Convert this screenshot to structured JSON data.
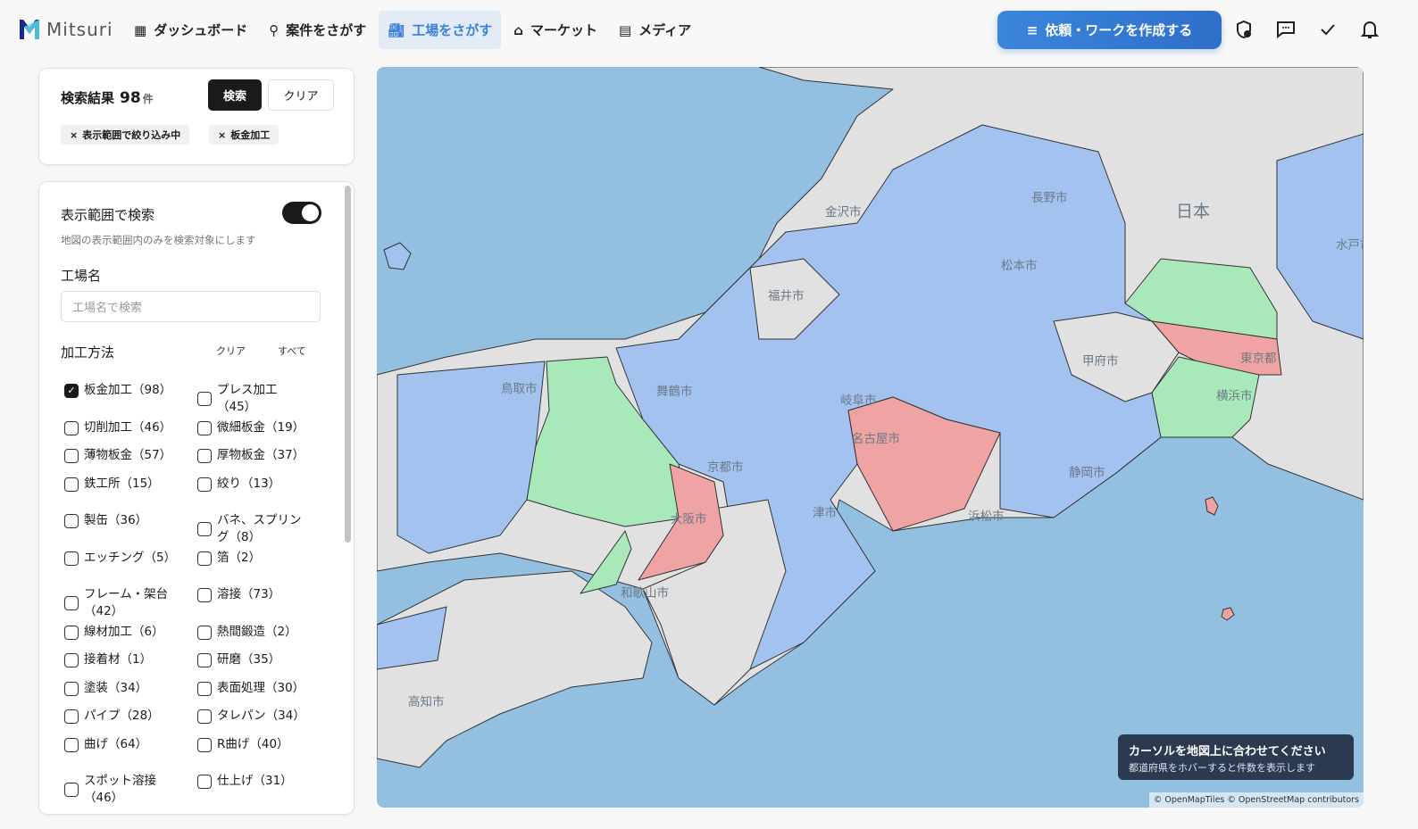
{
  "header": {
    "logo": "Mitsuri",
    "nav": [
      {
        "label": "ダッシュボード",
        "icon": "grid-icon"
      },
      {
        "label": "案件をさがす",
        "icon": "search-icon"
      },
      {
        "label": "工場をさがす",
        "icon": "factory-icon",
        "active": true
      },
      {
        "label": "マーケット",
        "icon": "store-icon"
      },
      {
        "label": "メディア",
        "icon": "newspaper-icon"
      }
    ],
    "cta_label": "依頼・ワークを作成する",
    "accent": "#3a86db"
  },
  "results": {
    "title": "検索結果",
    "count": "98",
    "unit": "件",
    "search_label": "検索",
    "clear_label": "クリア",
    "chips": [
      "表示範囲で絞り込み中",
      "板金加工"
    ]
  },
  "filters": {
    "viewport_title": "表示範囲で検索",
    "viewport_on": true,
    "viewport_hint": "地図の表示範囲内のみを検索対象にします",
    "name_title": "工場名",
    "name_placeholder": "工場名で検索",
    "method_title": "加工方法",
    "method_clear": "クリア",
    "method_all": "すべて",
    "methods": [
      {
        "label": "板金加工（98）",
        "checked": true
      },
      {
        "label": "プレス加工（45）",
        "checked": false
      },
      {
        "label": "切削加工（46）",
        "checked": false
      },
      {
        "label": "微細板金（19）",
        "checked": false
      },
      {
        "label": "薄物板金（57）",
        "checked": false
      },
      {
        "label": "厚物板金（37）",
        "checked": false
      },
      {
        "label": "鉄工所（15）",
        "checked": false
      },
      {
        "label": "絞り（13）",
        "checked": false
      },
      {
        "label": "製缶（36）",
        "checked": false
      },
      {
        "label": "バネ、スプリング（8）",
        "checked": false
      },
      {
        "label": "エッチング（5）",
        "checked": false
      },
      {
        "label": "箔（2）",
        "checked": false
      },
      {
        "label": "フレーム・架台（42）",
        "checked": false
      },
      {
        "label": "溶接（73）",
        "checked": false
      },
      {
        "label": "線材加工（6）",
        "checked": false
      },
      {
        "label": "熱間鍛造（2）",
        "checked": false
      },
      {
        "label": "接着材（1）",
        "checked": false
      },
      {
        "label": "研磨（35）",
        "checked": false
      },
      {
        "label": "塗装（34）",
        "checked": false
      },
      {
        "label": "表面処理（30）",
        "checked": false
      },
      {
        "label": "パイプ（28）",
        "checked": false
      },
      {
        "label": "タレパン（34）",
        "checked": false
      },
      {
        "label": "曲げ（64）",
        "checked": false
      },
      {
        "label": "R曲げ（40）",
        "checked": false
      },
      {
        "label": "スポット溶接（46）",
        "checked": false
      },
      {
        "label": "仕上げ（31）",
        "checked": false
      }
    ]
  },
  "map": {
    "cities": [
      "金沢市",
      "長野市",
      "日本",
      "水戸市",
      "松本市",
      "福井市",
      "甲府市",
      "東京都",
      "鳥取市",
      "舞鶴市",
      "岐阜市",
      "横浜市",
      "名古屋市",
      "京都市",
      "静岡市",
      "大阪市",
      "津市",
      "浜松市",
      "和歌山市",
      "高知市"
    ],
    "tooltip_title": "カーソルを地図上に合わせてください",
    "tooltip_hint": "都道府県をホバーすると件数を表示します",
    "attribution": "© OpenMapTiles © OpenStreetMap contributors",
    "colors": {
      "sea": "#93bfe0",
      "land": "#e1e1e1",
      "tier_low": "#a3c2ef",
      "tier_mid": "#a9e8b9",
      "tier_high": "#f0a3a3"
    }
  }
}
